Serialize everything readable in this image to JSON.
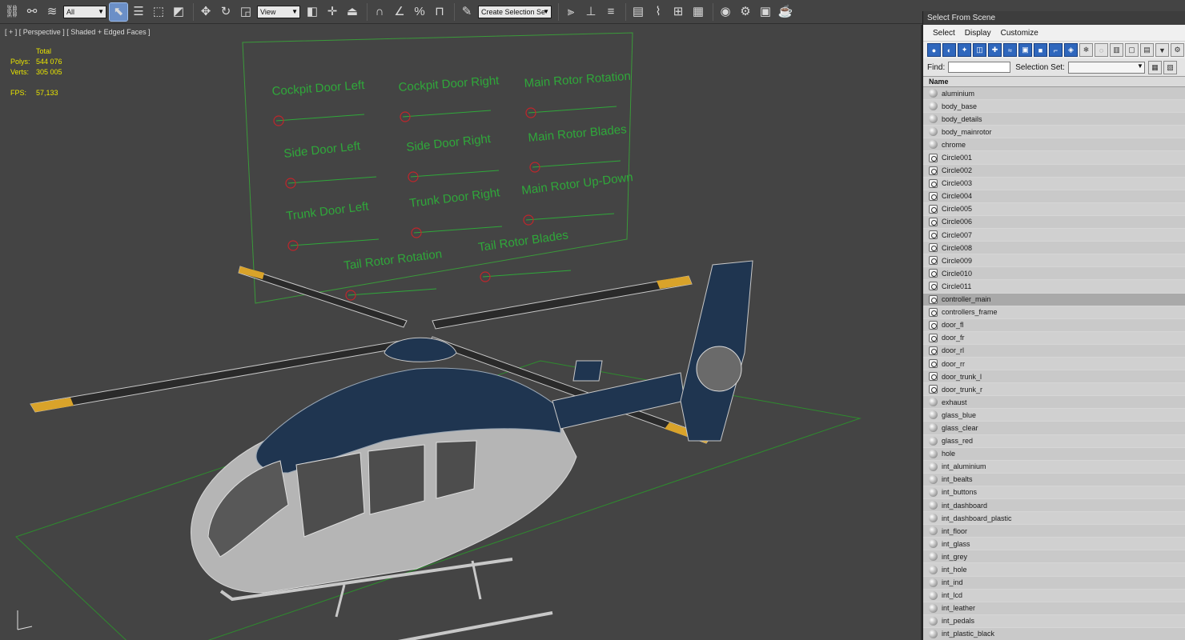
{
  "toolbar": {
    "filter_value": "All",
    "coord_value": "View",
    "selection_set_placeholder": "Create Selection Se",
    "icons": [
      "link-icon",
      "unlink-icon",
      "bind-space-warp-icon",
      "select-icon",
      "select-by-name-icon",
      "rect-select-icon",
      "window-crossing-icon",
      "move-icon",
      "rotate-icon",
      "scale-icon",
      "pivot-icon",
      "snap-icon",
      "angle-snap-icon",
      "percent-snap-icon",
      "spinner-snap-icon",
      "edit-named-selection-icon",
      "mirror-icon",
      "align-icon",
      "layer-manager-icon",
      "graphite-icon",
      "curve-editor-icon",
      "schematic-icon",
      "material-editor-icon",
      "render-setup-icon",
      "rendered-frame-icon",
      "render-icon"
    ]
  },
  "viewport": {
    "label": "[ + ] [ Perspective ] [ Shaded + Edged Faces ]",
    "stats": {
      "total_label": "Total",
      "polys_label": "Polys:",
      "polys_value": "544 076",
      "verts_label": "Verts:",
      "verts_value": "305 005",
      "fps_label": "FPS:",
      "fps_value": "57,133"
    },
    "controllers": [
      "Cockpit Door Left",
      "Cockpit Door Right",
      "Main Rotor Rotation",
      "Side Door Left",
      "Side  Door Right",
      "Main Rotor Blades",
      "Trunk Door Left",
      "Trunk Door Right",
      "Main Rotor Up-Down",
      "Tail Rotor Rotation",
      "Tail  Rotor Blades"
    ],
    "colors": {
      "label": "#2fa83a",
      "frame": "#3a9a3a",
      "knob": "#c0262b",
      "ground": "#2e8b2e",
      "body": "#1f3550",
      "wire": "#c8c8c8",
      "tip": "#d9a32a"
    }
  },
  "panel": {
    "title": "Select From Scene",
    "menu": [
      "Select",
      "Display",
      "Customize"
    ],
    "find_label": "Find:",
    "selection_set_label": "Selection Set:",
    "column_header": "Name",
    "items": [
      {
        "name": "aluminium",
        "type": "geo"
      },
      {
        "name": "body_base",
        "type": "geo"
      },
      {
        "name": "body_details",
        "type": "geo"
      },
      {
        "name": "body_mainrotor",
        "type": "geo"
      },
      {
        "name": "chrome",
        "type": "geo"
      },
      {
        "name": "Circle001",
        "type": "shape"
      },
      {
        "name": "Circle002",
        "type": "shape"
      },
      {
        "name": "Circle003",
        "type": "shape"
      },
      {
        "name": "Circle004",
        "type": "shape"
      },
      {
        "name": "Circle005",
        "type": "shape"
      },
      {
        "name": "Circle006",
        "type": "shape"
      },
      {
        "name": "Circle007",
        "type": "shape"
      },
      {
        "name": "Circle008",
        "type": "shape"
      },
      {
        "name": "Circle009",
        "type": "shape"
      },
      {
        "name": "Circle010",
        "type": "shape"
      },
      {
        "name": "Circle011",
        "type": "shape"
      },
      {
        "name": "controller_main",
        "type": "shape",
        "selected": true
      },
      {
        "name": "controllers_frame",
        "type": "shape"
      },
      {
        "name": "door_fl",
        "type": "shape"
      },
      {
        "name": "door_fr",
        "type": "shape"
      },
      {
        "name": "door_rl",
        "type": "shape"
      },
      {
        "name": "door_rr",
        "type": "shape"
      },
      {
        "name": "door_trunk_l",
        "type": "shape"
      },
      {
        "name": "door_trunk_r",
        "type": "shape"
      },
      {
        "name": "exhaust",
        "type": "geo"
      },
      {
        "name": "glass_blue",
        "type": "geo"
      },
      {
        "name": "glass_clear",
        "type": "geo"
      },
      {
        "name": "glass_red",
        "type": "geo"
      },
      {
        "name": "hole",
        "type": "geo"
      },
      {
        "name": "int_aluminium",
        "type": "geo"
      },
      {
        "name": "int_bealts",
        "type": "geo"
      },
      {
        "name": "int_buttons",
        "type": "geo"
      },
      {
        "name": "int_dashboard",
        "type": "geo"
      },
      {
        "name": "int_dashboard_plastic",
        "type": "geo"
      },
      {
        "name": "int_floor",
        "type": "geo"
      },
      {
        "name": "int_glass",
        "type": "geo"
      },
      {
        "name": "int_grey",
        "type": "geo"
      },
      {
        "name": "int_hole",
        "type": "geo"
      },
      {
        "name": "int_ind",
        "type": "geo"
      },
      {
        "name": "int_lcd",
        "type": "geo"
      },
      {
        "name": "int_leather",
        "type": "geo"
      },
      {
        "name": "int_pedals",
        "type": "geo"
      },
      {
        "name": "int_plastic_black",
        "type": "geo"
      }
    ]
  }
}
